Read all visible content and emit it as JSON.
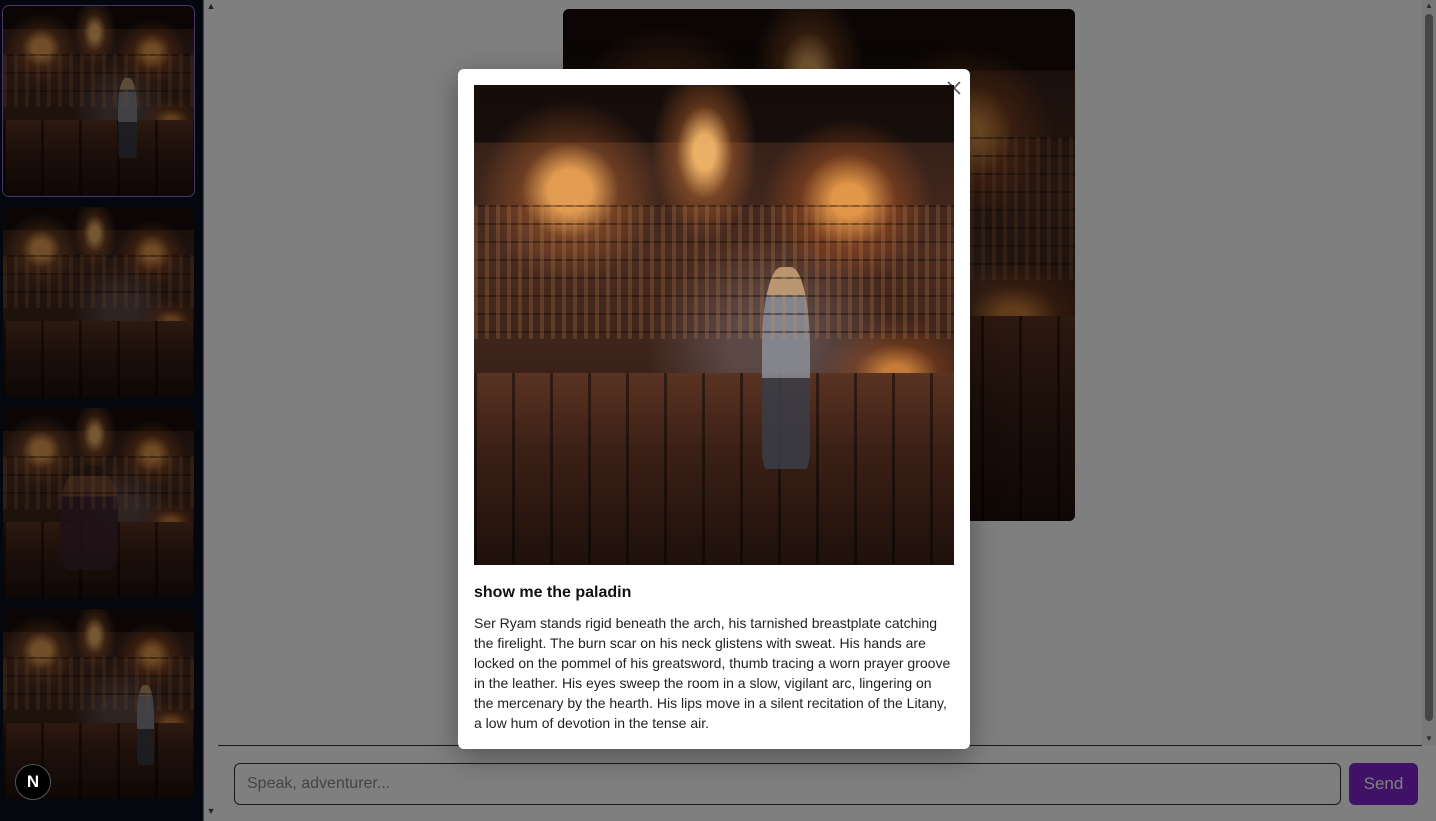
{
  "sidebar": {
    "thumbnails": [
      {
        "label": "tavern scene 1",
        "selected": true
      },
      {
        "label": "tavern scene 2",
        "selected": false
      },
      {
        "label": "tavern scene 3",
        "selected": false
      },
      {
        "label": "tavern scene 4",
        "selected": false
      }
    ],
    "badge_letter": "N"
  },
  "story": {
    "text_visible_fragments": [
      "arnished",
      "on his neck",
      "ommel of his",
      "n the leather.",
      "gering on the",
      "recitation of",
      "se air."
    ]
  },
  "chat": {
    "placeholder": "Speak, adventurer...",
    "send_label": "Send"
  },
  "modal": {
    "title": "show me the paladin",
    "body": "Ser Ryam stands rigid beneath the arch, his tarnished breastplate catching the firelight. The burn scar on his neck glistens with sweat. His hands are locked on the pommel of his greatsword, thumb tracing a worn prayer groove in the leather. His eyes sweep the room in a slow, vigilant arc, lingering on the mercenary by the hearth. His lips move in a silent recitation of the Litany, a low hum of devotion in the tense air.",
    "close_icon": "close-icon"
  },
  "colors": {
    "accent": "#7e22ce",
    "selected_outline": "#8c6fd1",
    "sidebar_bg": "#0b0f1f"
  }
}
